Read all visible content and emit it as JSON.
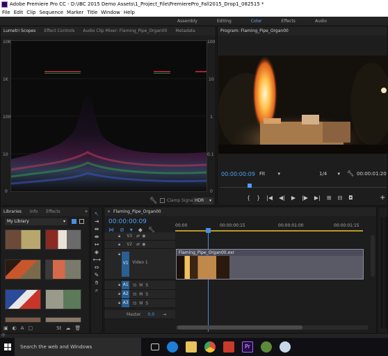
{
  "window": {
    "title": "Adobe Premiere Pro CC - D:\\IBC 2015 Demo Assets\\1_Project_File\\PremierePro_Fall2015_Drop1_082515 *"
  },
  "menu": [
    "File",
    "Edit",
    "Clip",
    "Sequence",
    "Marker",
    "Title",
    "Window",
    "Help"
  ],
  "workspaces": [
    {
      "label": "Assembly",
      "active": false
    },
    {
      "label": "Editing",
      "active": false
    },
    {
      "label": "Color",
      "active": true
    },
    {
      "label": "Effects",
      "active": false
    },
    {
      "label": "Audio",
      "active": false
    }
  ],
  "source_panel": {
    "tabs": [
      "Lumetri Scopes",
      "Effect Controls",
      "Audio Clip Mixer: Flaming_Pipe_Organ00",
      "Metadata"
    ],
    "scale_left": [
      "10K",
      "1K",
      "100",
      "10",
      "0"
    ],
    "scale_right": [
      "100",
      "10",
      "1",
      "0.1",
      "0"
    ],
    "clamp_signal": "Clamp Signal",
    "hdr_label": "HDR"
  },
  "program": {
    "title": "Program: Flaming_Pipe_Organ00",
    "timecode": "00:00:00:09",
    "fit_label": "Fit",
    "quality": "1/4",
    "duration": "00:00:01:20"
  },
  "libraries": {
    "tabs": [
      "Libraries",
      "Info",
      "Effects"
    ],
    "dropdown": "My Library"
  },
  "timeline": {
    "tab": "Flaming_Pipe_Organ00",
    "timecode": "00:00:00:09",
    "ruler": [
      "00:00",
      "00:00:00:15",
      "00:00:01:00",
      "00:00:01:15"
    ],
    "video_tracks": [
      "V3",
      "V2",
      "V1"
    ],
    "v1_name": "Video 1",
    "audio_tracks": [
      "A1",
      "A2",
      "A3"
    ],
    "master_label": "Master",
    "master_value": "0.0",
    "clip_name": "Flaming_Pipe_Organ00.exr"
  },
  "taskbar": {
    "search_placeholder": "Search the web and Windows"
  }
}
